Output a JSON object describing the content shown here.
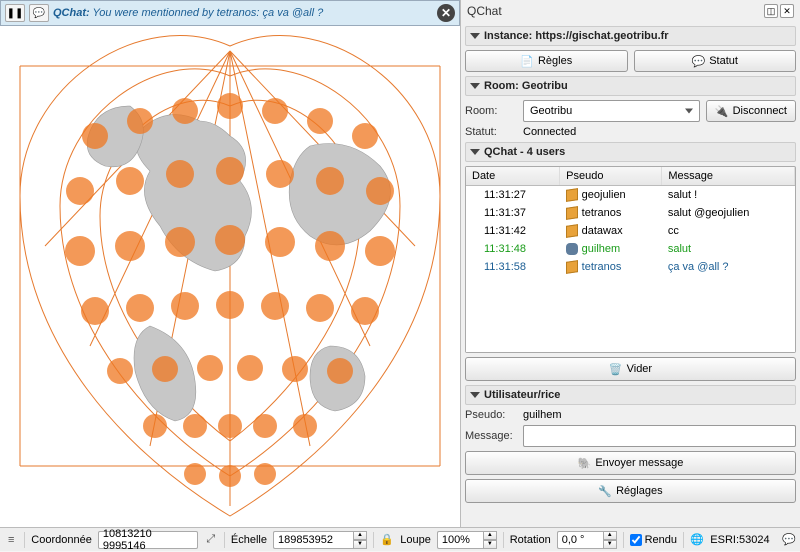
{
  "notification": {
    "title": "QChat:",
    "text": " You were mentionned by tetranos: ça va @all ?"
  },
  "panel": {
    "title": "QChat",
    "instance": {
      "header": "Instance: https://gischat.geotribu.fr",
      "rules_btn": "Règles",
      "status_btn": "Statut"
    },
    "room": {
      "header": "Room: Geotribu",
      "room_label": "Room:",
      "room_value": "Geotribu",
      "disconnect_btn": "Disconnect",
      "status_label": "Statut:",
      "status_value": "Connected"
    },
    "chat": {
      "header": "QChat - 4 users",
      "columns": {
        "c1": "Date",
        "c2": "Pseudo",
        "c3": "Message"
      },
      "rows": [
        {
          "date": "11:31:27",
          "pseudo": "geojulien",
          "msg": "salut !",
          "cls": "",
          "icon": "cube"
        },
        {
          "date": "11:31:37",
          "pseudo": "tetranos",
          "msg": "salut @geojulien",
          "cls": "",
          "icon": "cube"
        },
        {
          "date": "11:31:42",
          "pseudo": "datawax",
          "msg": "cc",
          "cls": "",
          "icon": "cube"
        },
        {
          "date": "11:31:48",
          "pseudo": "guilhem",
          "msg": "salut",
          "cls": "row-green",
          "icon": "eleph"
        },
        {
          "date": "11:31:58",
          "pseudo": "tetranos",
          "msg": "ça va @all ?",
          "cls": "row-blue",
          "icon": "cube"
        }
      ],
      "clear_btn": "Vider"
    },
    "user": {
      "header": "Utilisateur/rice",
      "pseudo_label": "Pseudo:",
      "pseudo_value": "guilhem",
      "message_label": "Message:",
      "send_btn": "Envoyer message",
      "settings_btn": "Réglages"
    }
  },
  "statusbar": {
    "coord_label": "Coordonnée",
    "coord_value": "10813210 9995146",
    "scale_label": "Échelle",
    "scale_value": "189853952",
    "loupe_label": "Loupe",
    "loupe_value": "100%",
    "rotation_label": "Rotation",
    "rotation_value": "0,0 °",
    "render_label": "Rendu",
    "crs_label": "ESRI:53024"
  }
}
